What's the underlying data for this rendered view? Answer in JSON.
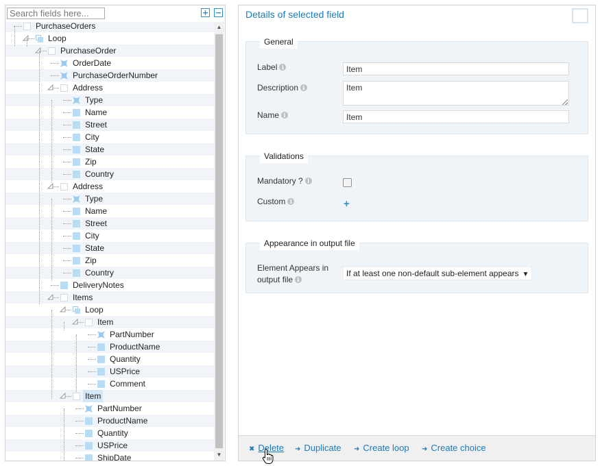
{
  "search": {
    "placeholder": "Search fields here..."
  },
  "tree": {
    "rows": [
      {
        "label": "PurchaseOrders",
        "icon": "group-icon"
      },
      {
        "label": "Loop",
        "icon": "loop-icon"
      },
      {
        "label": "PurchaseOrder",
        "icon": "group-icon"
      },
      {
        "label": "OrderDate",
        "icon": "attribute-icon"
      },
      {
        "label": "PurchaseOrderNumber",
        "icon": "attribute-icon"
      },
      {
        "label": "Address",
        "icon": "group-icon"
      },
      {
        "label": "Type",
        "icon": "attribute-icon"
      },
      {
        "label": "Name",
        "icon": "element-icon"
      },
      {
        "label": "Street",
        "icon": "element-icon"
      },
      {
        "label": "City",
        "icon": "element-icon"
      },
      {
        "label": "State",
        "icon": "element-icon"
      },
      {
        "label": "Zip",
        "icon": "element-icon"
      },
      {
        "label": "Country",
        "icon": "element-icon"
      },
      {
        "label": "Address",
        "icon": "group-icon"
      },
      {
        "label": "Type",
        "icon": "attribute-icon"
      },
      {
        "label": "Name",
        "icon": "element-icon"
      },
      {
        "label": "Street",
        "icon": "element-icon"
      },
      {
        "label": "City",
        "icon": "element-icon"
      },
      {
        "label": "State",
        "icon": "element-icon"
      },
      {
        "label": "Zip",
        "icon": "element-icon"
      },
      {
        "label": "Country",
        "icon": "element-icon"
      },
      {
        "label": "DeliveryNotes",
        "icon": "element-icon"
      },
      {
        "label": "Items",
        "icon": "group-icon"
      },
      {
        "label": "Loop",
        "icon": "loop-icon"
      },
      {
        "label": "Item",
        "icon": "group-icon"
      },
      {
        "label": "PartNumber",
        "icon": "attribute-icon"
      },
      {
        "label": "ProductName",
        "icon": "element-icon"
      },
      {
        "label": "Quantity",
        "icon": "element-icon"
      },
      {
        "label": "USPrice",
        "icon": "element-icon"
      },
      {
        "label": "Comment",
        "icon": "element-icon"
      },
      {
        "label": "Item",
        "icon": "group-icon",
        "selected": true
      },
      {
        "label": "PartNumber",
        "icon": "attribute-icon"
      },
      {
        "label": "ProductName",
        "icon": "element-icon"
      },
      {
        "label": "Quantity",
        "icon": "element-icon"
      },
      {
        "label": "USPrice",
        "icon": "element-icon"
      },
      {
        "label": "ShipDate",
        "icon": "element-icon"
      }
    ]
  },
  "details": {
    "title": "Details of selected field",
    "general": {
      "legend": "General",
      "label_label": "Label",
      "label_value": "Item",
      "description_label": "Description",
      "description_value": "Item",
      "name_label": "Name",
      "name_value": "Item"
    },
    "validations": {
      "legend": "Validations",
      "mandatory_label": "Mandatory ?",
      "mandatory_checked": false,
      "custom_label": "Custom",
      "add_symbol": "+"
    },
    "appearance": {
      "legend": "Appearance in output file",
      "element_appears_label_line1": "Element Appears in",
      "element_appears_label_line2": "output file",
      "select_value": "If at least one non-default sub-element appears"
    }
  },
  "footer": {
    "delete_label": "Delete",
    "duplicate_label": "Duplicate",
    "create_loop_label": "Create loop",
    "create_choice_label": "Create choice"
  }
}
